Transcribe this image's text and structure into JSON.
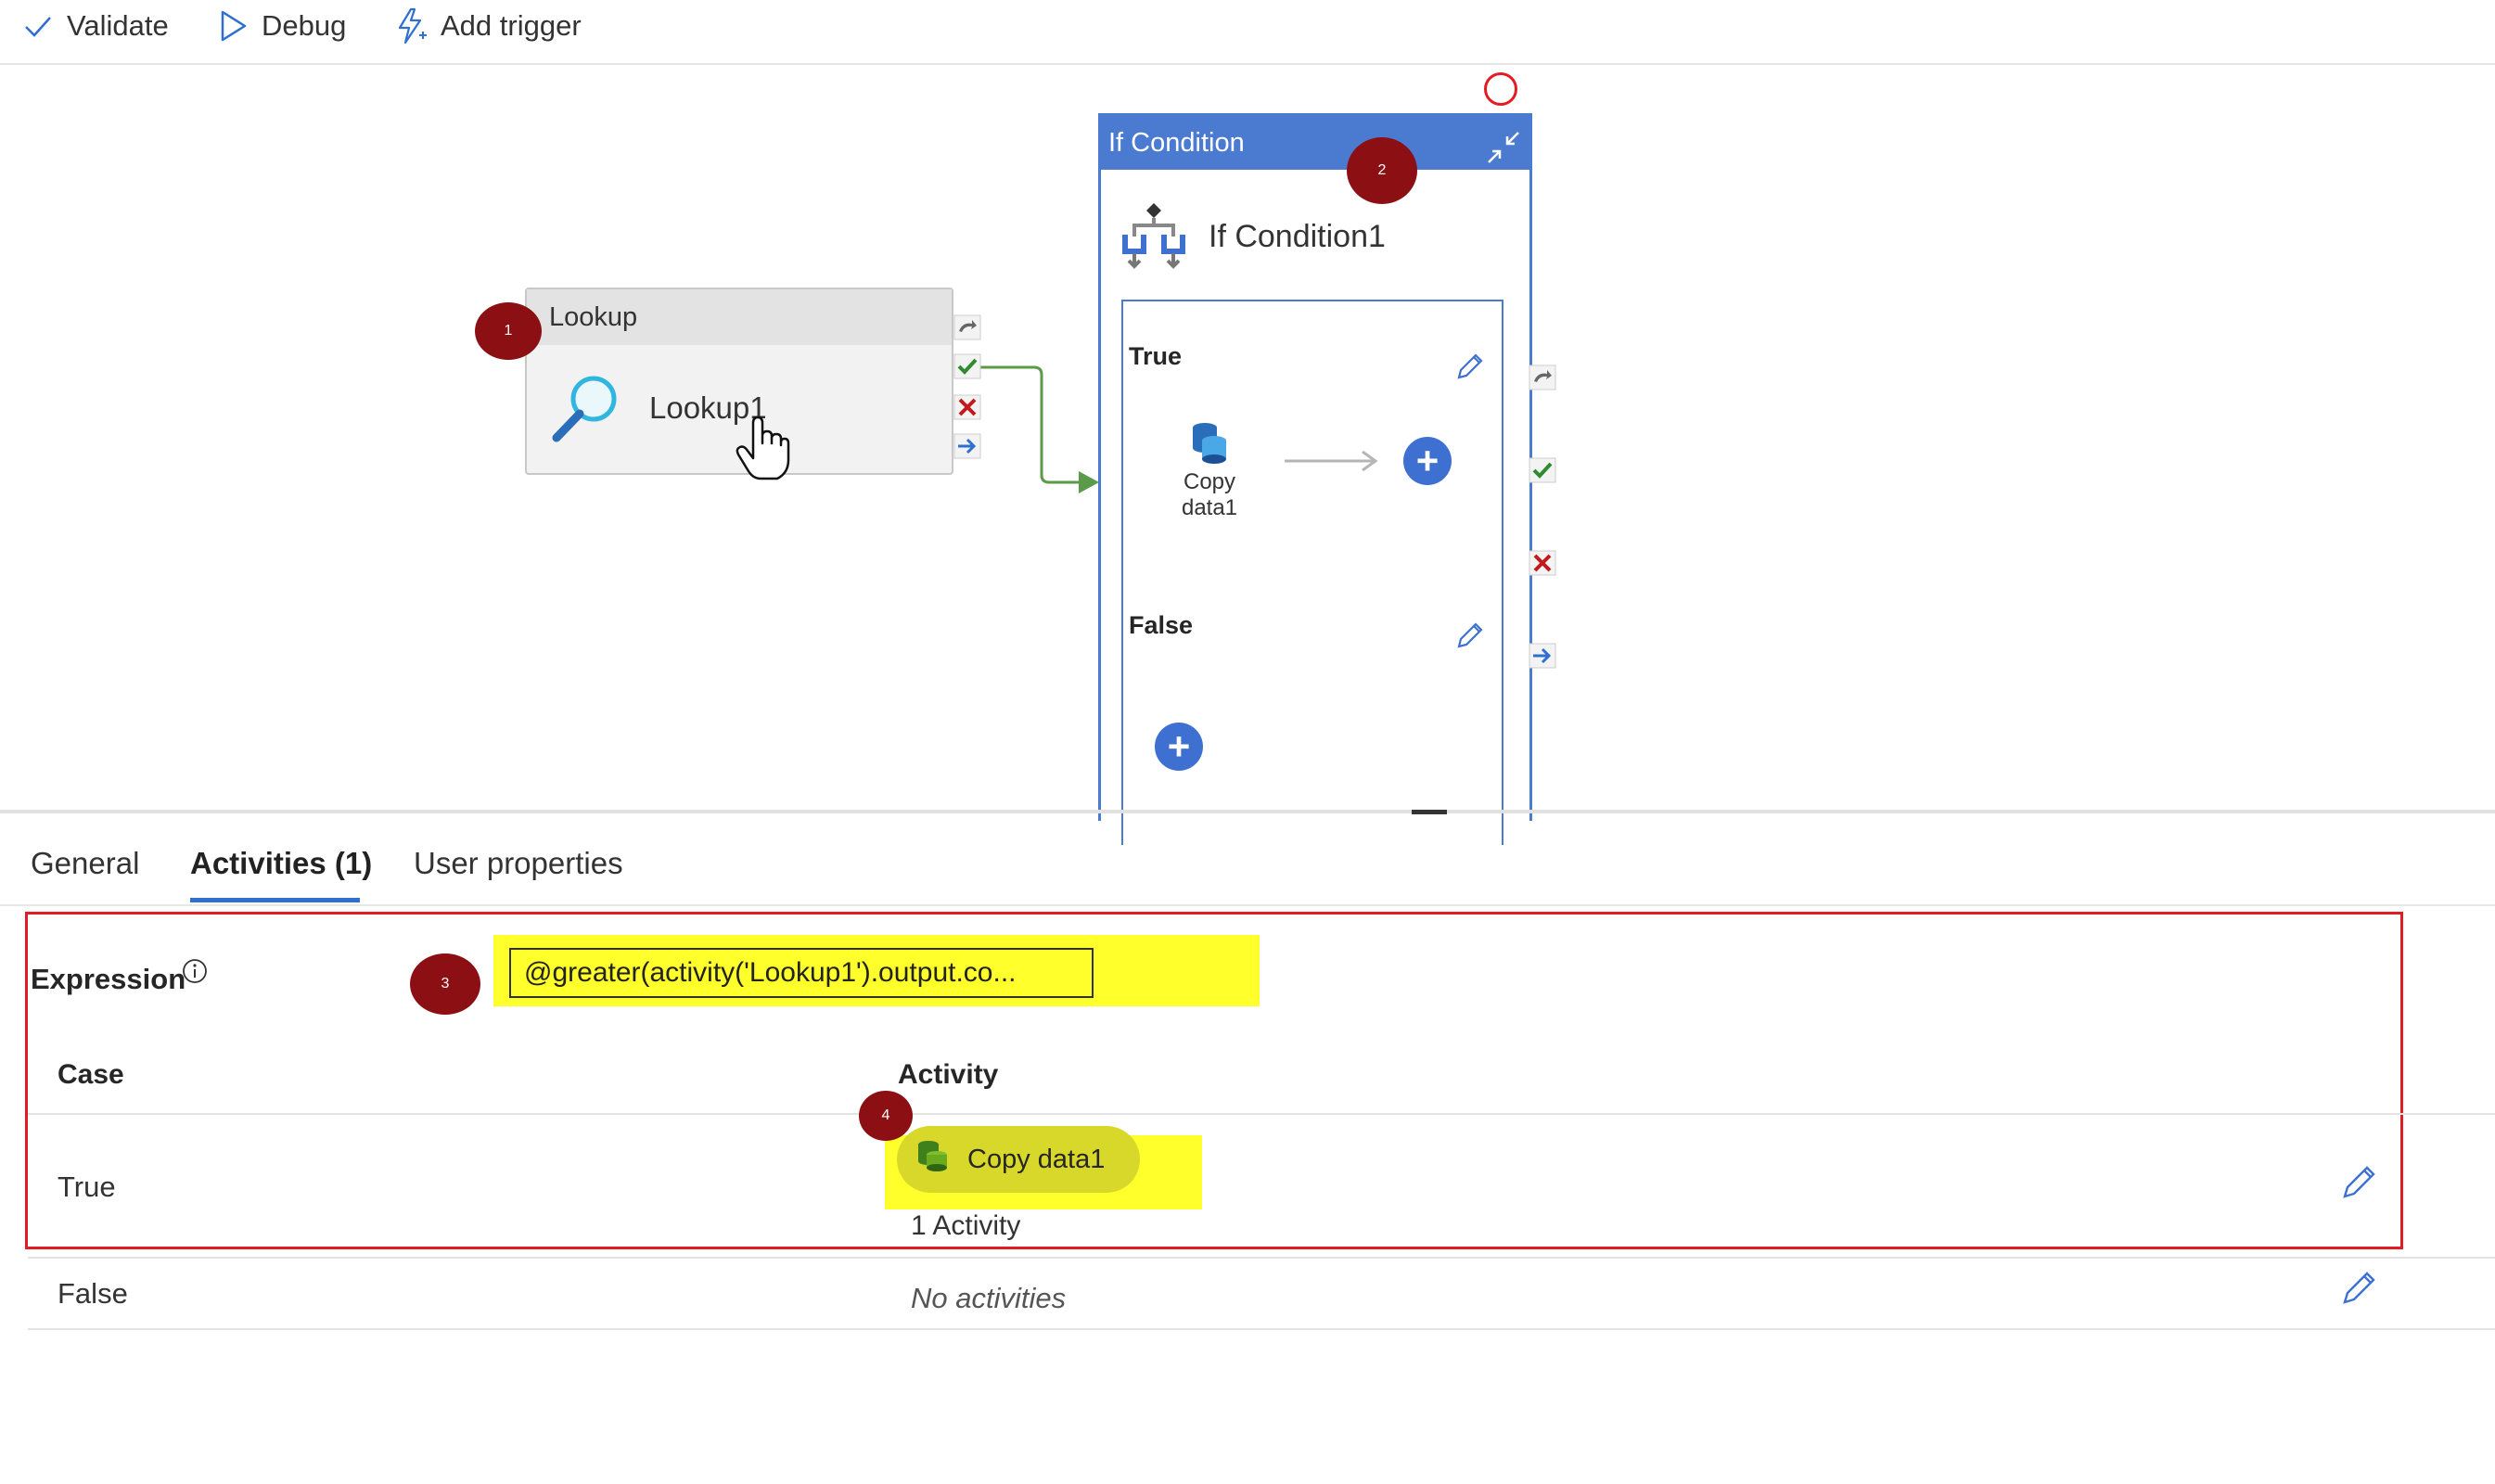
{
  "toolbar": {
    "validate_label": "Validate",
    "debug_label": "Debug",
    "add_trigger_label": "Add trigger"
  },
  "canvas": {
    "lookup_node": {
      "type_label": "Lookup",
      "name": "Lookup1",
      "badge": "1"
    },
    "if_condition": {
      "type_label": "If Condition",
      "name": "If Condition1",
      "badge": "2",
      "true_branch": {
        "label": "True",
        "activity_line1": "Copy",
        "activity_line2": "data1"
      },
      "false_branch": {
        "label": "False"
      }
    }
  },
  "panel": {
    "tabs": [
      {
        "label": "General"
      },
      {
        "label": "Activities (1)"
      },
      {
        "label": "User properties"
      }
    ],
    "expression_label": "Expression",
    "expression_value": "@greater(activity('Lookup1').output.co...",
    "expression_badge": "3",
    "case_header": "Case",
    "activity_header": "Activity",
    "rows": [
      {
        "case": "True",
        "activity_name": "Copy data1",
        "activity_count": "1 Activity",
        "badge": "4"
      },
      {
        "case": "False",
        "no_activities": "No activities"
      }
    ]
  },
  "colors": {
    "accent": "#4b7bd1",
    "success": "#2e8b2e",
    "failure": "#c0191e",
    "highlight": "#ffff2b",
    "annotation_badge": "#8b0f13",
    "annotation_box": "#e31b23"
  }
}
